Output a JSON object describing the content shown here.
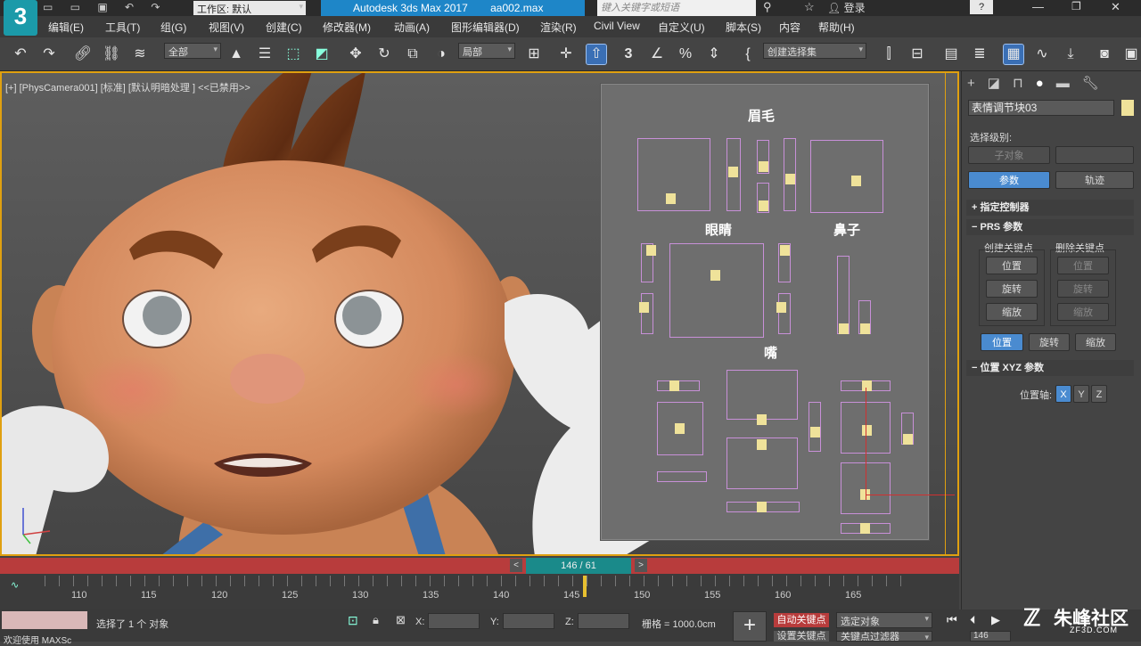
{
  "app": {
    "logo": "3",
    "title": "Autodesk 3ds Max 2017",
    "file": "aa002.max",
    "workspace": "工作区: 默认",
    "search_placeholder": "键入关键字或短语",
    "login": "登录",
    "help_num": "?"
  },
  "menu": [
    "编辑(E)",
    "工具(T)",
    "组(G)",
    "视图(V)",
    "创建(C)",
    "修改器(M)",
    "动画(A)",
    "图形编辑器(D)",
    "渲染(R)",
    "Civil View",
    "自定义(U)",
    "脚本(S)",
    "内容",
    "帮助(H)"
  ],
  "toolbar": {
    "filter": "全部",
    "ref_coord": "局部",
    "selset": "创建选择集"
  },
  "viewport": {
    "label": "[+] [PhysCamera001] [标准] [默认明暗处理 ] <<已禁用>>"
  },
  "board": {
    "eyebrow": "眉毛",
    "eye": "眼睛",
    "nose": "鼻子",
    "mouth": "嘴"
  },
  "panel": {
    "object_name": "表情调节块03",
    "select_level": "选择级别:",
    "sub_object": "子对象",
    "params": "参数",
    "track": "轨迹",
    "assign_ctrl": "指定控制器",
    "prs": "PRS 参数",
    "create_key": "创建关键点",
    "delete_key": "删除关键点",
    "pos": "位置",
    "rot": "旋转",
    "scale": "缩放",
    "pos_xyz": "位置 XYZ 参数",
    "pos_axis": "位置轴:",
    "x": "X",
    "y": "Y",
    "z": "Z"
  },
  "timeline": {
    "frame": "146 / 61",
    "ticks": [
      "110",
      "115",
      "120",
      "125",
      "130",
      "135",
      "140",
      "145",
      "150",
      "155",
      "160",
      "165"
    ]
  },
  "status": {
    "maxscript": "欢迎使用 MAXSc",
    "selected": "选择了 1 个 对象",
    "x": "X:",
    "y": "Y:",
    "z": "Z:",
    "grid": "栅格 = 1000.0cm",
    "autokey": "自动关键点",
    "setkey": "设置关键点",
    "sel_obj": "选定对象",
    "key_filter": "关键点过滤器",
    "frame": "146",
    "watermark": "朱峰社区",
    "watermark_sub": "ZF3D.COM"
  }
}
